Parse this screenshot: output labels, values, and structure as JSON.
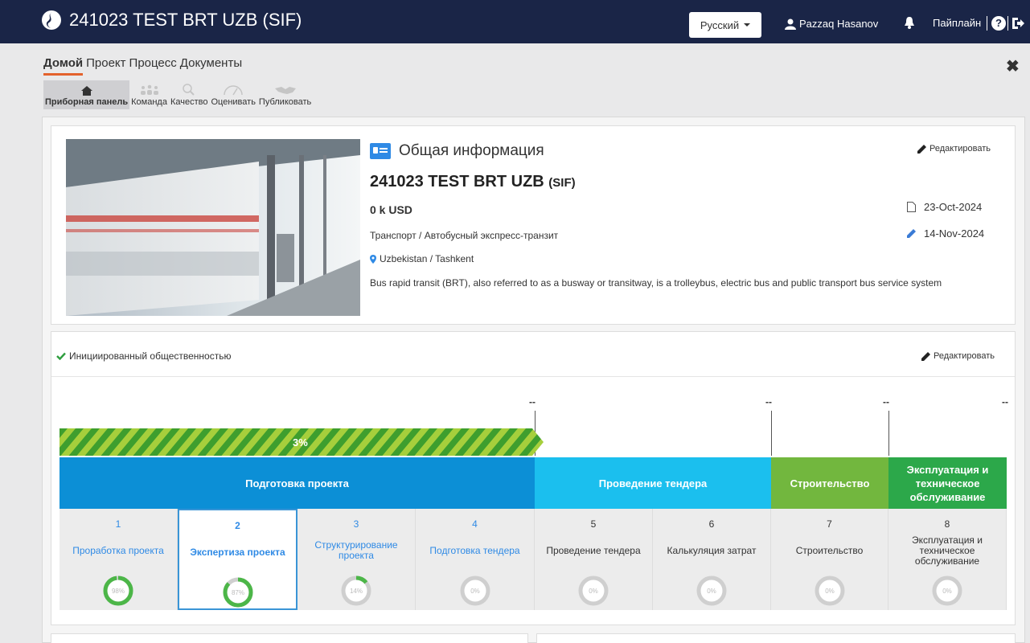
{
  "header": {
    "title": "241023 TEST BRT UZB (SIF)",
    "language": "Русский",
    "user": "Pazzaq Hasanov",
    "pipeline": "Пайплайн"
  },
  "nav": {
    "tabs": [
      "Домой",
      "Проект",
      "Процесс",
      "Документы"
    ]
  },
  "subnav": {
    "items": [
      {
        "label": "Приборная панель",
        "icon": "home-icon"
      },
      {
        "label": "Команда",
        "icon": "team-icon"
      },
      {
        "label": "Качество",
        "icon": "quality-icon"
      },
      {
        "label": "Оценивать",
        "icon": "gauge-icon"
      },
      {
        "label": "Публиковать",
        "icon": "handshake-icon"
      }
    ]
  },
  "info": {
    "section_title": "Общая информация",
    "edit_label": "Редактировать",
    "project_name": "241023 TEST BRT UZB",
    "project_suffix": "(SIF)",
    "amount": "0 k USD",
    "sector": "Транспорт / Автобусный экспресс-транзит",
    "location": "Uzbekistan / Tashkent",
    "description": "Bus rapid transit (BRT), also referred to as a busway or transitway, is a trolleybus, electric bus and public transport bus service system",
    "created": "23-Oct-2024",
    "updated": "14-Nov-2024"
  },
  "timeline": {
    "status": "Инициированный общественностью",
    "edit_label": "Редактировать",
    "progress_label": "3%",
    "progress": 0.03,
    "dash": "--",
    "phases": [
      {
        "label": "Подготовка проекта",
        "color": "#0c8fd6"
      },
      {
        "label": "Проведение тендера",
        "color": "#1bbfee"
      },
      {
        "label": "Строительство",
        "color": "#72b73e"
      },
      {
        "label": "Эксплуатация и техническое обслуживание",
        "color": "#2ca84a"
      }
    ],
    "steps": [
      {
        "num": "1",
        "label": "Проработка проекта",
        "pct": "98%",
        "value": 98
      },
      {
        "num": "2",
        "label": "Экспертиза проекта",
        "pct": "87%",
        "value": 87
      },
      {
        "num": "3",
        "label": "Структурирование проекта",
        "pct": "14%",
        "value": 14
      },
      {
        "num": "4",
        "label": "Подготовка тендера",
        "pct": "0%",
        "value": 0
      },
      {
        "num": "5",
        "label": "Проведение тендера",
        "pct": "0%",
        "value": 0
      },
      {
        "num": "6",
        "label": "Калькуляция затрат",
        "pct": "0%",
        "value": 0
      },
      {
        "num": "7",
        "label": "Строительство",
        "pct": "0%",
        "value": 0
      },
      {
        "num": "8",
        "label": "Эксплуатация и техническое обслуживание",
        "pct": "0%",
        "value": 0
      }
    ]
  },
  "colors": {
    "topbar": "#1a2547",
    "accent": "#e3622c",
    "ring_green": "#4cb648",
    "link_blue": "#2f8ae5"
  }
}
